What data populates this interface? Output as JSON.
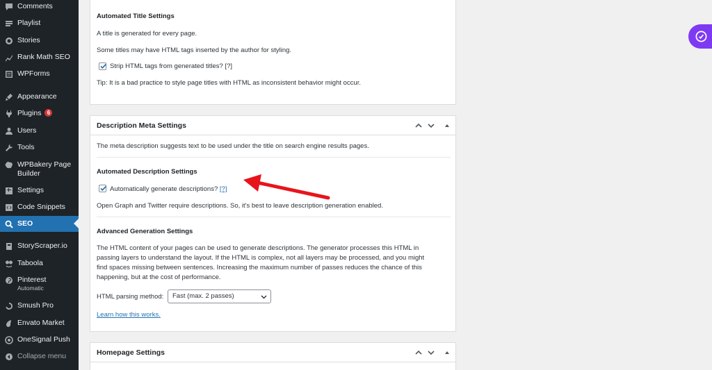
{
  "sidebar": {
    "items": [
      {
        "label": "Comments",
        "icon": "comments-icon"
      },
      {
        "label": "Playlist",
        "icon": "playlist-icon"
      },
      {
        "label": "Stories",
        "icon": "stories-icon"
      },
      {
        "label": "Rank Math SEO",
        "icon": "rank-math-icon"
      },
      {
        "label": "WPForms",
        "icon": "wpforms-icon"
      },
      {
        "label": "Appearance",
        "icon": "appearance-icon"
      },
      {
        "label": "Plugins",
        "icon": "plugins-icon",
        "badge": "6"
      },
      {
        "label": "Users",
        "icon": "users-icon"
      },
      {
        "label": "Tools",
        "icon": "tools-icon"
      },
      {
        "label": "WPBakery Page",
        "label2": "Builder",
        "icon": "wpbakery-icon"
      },
      {
        "label": "Settings",
        "icon": "settings-icon"
      },
      {
        "label": "Code Snippets",
        "icon": "code-snippets-icon"
      },
      {
        "label": "SEO",
        "icon": "seo-icon",
        "active": true
      },
      {
        "label": "StoryScraper.io",
        "icon": "storyscraper-icon"
      },
      {
        "label": "Taboola",
        "icon": "taboola-icon"
      },
      {
        "label": "Pinterest",
        "sub": "Automatic",
        "icon": "pinterest-icon"
      },
      {
        "label": "Smush Pro",
        "icon": "smush-icon"
      },
      {
        "label": "Envato Market",
        "icon": "envato-icon"
      },
      {
        "label": "OneSignal Push",
        "icon": "onesignal-icon"
      }
    ],
    "collapse_label": "Collapse menu"
  },
  "title_panel": {
    "heading": "Automated Title Settings",
    "line1": "A title is generated for every page.",
    "line2": "Some titles may have HTML tags inserted by the author for styling.",
    "checkbox_label": "Strip HTML tags from generated titles?",
    "checkbox_help": "[?]",
    "checkbox_checked": true,
    "tip": "Tip: It is a bad practice to style page titles with HTML as inconsistent behavior might occur."
  },
  "desc_panel": {
    "title": "Description Meta Settings",
    "intro": "The meta description suggests text to be used under the title on search engine results pages.",
    "auto_heading": "Automated Description Settings",
    "auto_checkbox_label": "Automatically generate descriptions?",
    "auto_checkbox_help": "[?]",
    "auto_checkbox_checked": true,
    "og_note": "Open Graph and Twitter require descriptions. So, it's best to leave description generation enabled.",
    "adv_heading": "Advanced Generation Settings",
    "adv_text": "The HTML content of your pages can be used to generate descriptions. The generator processes this HTML in passing layers to understand the layout. If the HTML is complex, not all layers may be processed, and you might find spaces missing between sentences. Increasing the maximum number of passes reduces the chance of this happening, but at the cost of performance.",
    "parsing_label": "HTML parsing method:",
    "parsing_value": "Fast (max. 2 passes)",
    "learn_link": "Learn how this works."
  },
  "home_panel": {
    "title": "Homepage Settings"
  },
  "colors": {
    "sidebar_bg": "#1d2327",
    "active_bg": "#2271b1",
    "badge": "#d63638",
    "link": "#2271b1",
    "annotation_arrow": "#e8141c",
    "widget": "#7e3af2"
  }
}
